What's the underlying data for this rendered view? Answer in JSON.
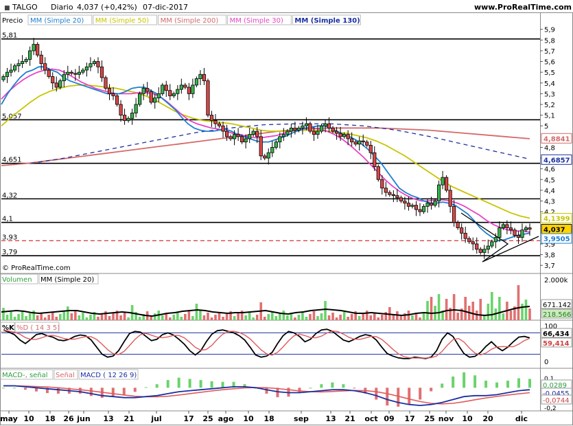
{
  "header": {
    "symbol": "TALGO",
    "period": "Diario",
    "quote": "4,037 (+0,42%)",
    "date": "07-dic-2017",
    "site": "www.ProRealTime.com"
  },
  "legend_main": {
    "price": "Precio",
    "items": [
      {
        "label": "MM (Simple 20)",
        "color": "#1e7fd0"
      },
      {
        "label": "MM (Simple 50)",
        "color": "#c8c400"
      },
      {
        "label": "MM (Simple 200)",
        "color": "#d46a6a"
      },
      {
        "label": "MM (Simple 30)",
        "color": "#e844c4"
      },
      {
        "label": "MM (Simple 130)",
        "color": "#1a2fa0"
      }
    ]
  },
  "copyright": "© ProRealTime.com",
  "level_labels": [
    "5,81",
    "5,057",
    "4,651",
    "4,32",
    "4,1",
    "3,93",
    "3,79"
  ],
  "price_axis_ticks": [
    "5,9",
    "5,8",
    "5,7",
    "5,6",
    "5,5",
    "5,4",
    "5,3",
    "5,2",
    "5,1",
    "5",
    "4,8",
    "4,7",
    "4,6",
    "4,5",
    "4,4",
    "4,3",
    "4,2",
    "3,9",
    "3,8",
    "3,7"
  ],
  "right_value_tags": [
    {
      "label": "4,8841",
      "value": 4.8841,
      "color": "#d46a6a"
    },
    {
      "label": "4,6857",
      "value": 4.6857,
      "color": "#1a2fa0"
    },
    {
      "label": "4,1399",
      "value": 4.1399,
      "color": "#c8c400"
    },
    {
      "label": "4,037",
      "value": 4.037,
      "color": "#000000"
    },
    {
      "label": "3,9505",
      "value": 3.9505,
      "color": "#1e7fd0"
    }
  ],
  "volume": {
    "legend": [
      "Volumen",
      "MM (Simple 20)"
    ],
    "axis_ticks": [
      "2.000k"
    ],
    "tags": [
      "671.142",
      "218.566"
    ]
  },
  "stochastic": {
    "legend": [
      "%K",
      "%D ( 14 3 5)"
    ],
    "axis_ticks": [
      "100",
      "50",
      "0"
    ],
    "tags": [
      "66,434",
      "59,414"
    ]
  },
  "macd": {
    "legend": [
      "MACD-, señal",
      "Señal",
      "MACD ( 12 26 9)"
    ],
    "axis_ticks": [
      "0,1",
      "-0,1",
      "-0,2"
    ],
    "tags": [
      "0,0289",
      "-0,0455",
      "-0,0744"
    ]
  },
  "x_axis_labels": [
    "may",
    "10",
    "18",
    "26",
    "jun",
    "13",
    "21",
    "jul",
    "17",
    "25",
    "ago",
    "10",
    "18",
    "sep",
    "13",
    "21",
    "oct",
    "09",
    "17",
    "25",
    "nov",
    "10",
    "20",
    "dic"
  ],
  "chart_data": {
    "type": "candlestick",
    "title": "TALGO Diario",
    "ylim": [
      3.65,
      5.93
    ],
    "horizontal_levels": [
      5.81,
      5.057,
      4.651,
      4.32,
      4.1,
      3.79
    ],
    "dashed_level": 3.93,
    "series": [
      {
        "name": "Precio",
        "values": [
          5.46,
          5.5,
          5.52,
          5.56,
          5.58,
          5.6,
          5.62,
          5.7,
          5.76,
          5.66,
          5.58,
          5.52,
          5.46,
          5.4,
          5.36,
          5.42,
          5.48,
          5.5,
          5.49,
          5.48,
          5.5,
          5.52,
          5.55,
          5.58,
          5.6,
          5.55,
          5.45,
          5.35,
          5.3,
          5.28,
          5.2,
          5.1,
          5.05,
          5.07,
          5.12,
          5.2,
          5.3,
          5.35,
          5.32,
          5.22,
          5.26,
          5.3,
          5.38,
          5.33,
          5.28,
          5.3,
          5.34,
          5.38,
          5.36,
          5.3,
          5.38,
          5.44,
          5.48,
          5.42,
          5.1,
          5.05,
          5.02,
          5.0,
          4.95,
          4.9,
          4.88,
          4.92,
          4.9,
          4.85,
          4.88,
          4.92,
          4.95,
          4.9,
          4.72,
          4.7,
          4.75,
          4.8,
          4.85,
          4.9,
          4.92,
          4.95,
          4.98,
          4.96,
          4.98,
          5.0,
          5.02,
          4.95,
          4.92,
          4.95,
          5.0,
          5.02,
          4.98,
          4.95,
          4.93,
          4.9,
          4.92,
          4.88,
          4.85,
          4.83,
          4.86,
          4.85,
          4.82,
          4.75,
          4.62,
          4.5,
          4.42,
          4.38,
          4.36,
          4.35,
          4.33,
          4.3,
          4.28,
          4.25,
          4.26,
          4.22,
          4.2,
          4.25,
          4.28,
          4.26,
          4.3,
          4.45,
          4.52,
          4.4,
          4.25,
          4.1,
          4.05,
          4.0,
          3.95,
          3.92,
          3.9,
          3.85,
          3.82,
          3.85,
          3.88,
          3.92,
          3.96,
          4.05,
          4.08,
          4.05,
          4.03,
          3.98,
          3.96,
          4.03,
          4.05,
          4.037
        ]
      },
      {
        "name": "MM (Simple 20)",
        "values": [
          5.2,
          5.3,
          5.38,
          5.45,
          5.5,
          5.52,
          5.55,
          5.55,
          5.52,
          5.5,
          5.45,
          5.42,
          5.4,
          5.38,
          5.36,
          5.34,
          5.32,
          5.3,
          5.3,
          5.3,
          5.32,
          5.35,
          5.36,
          5.36,
          5.33,
          5.3,
          5.25,
          5.2,
          5.15,
          5.08,
          5.02,
          4.98,
          4.96,
          4.95,
          4.95,
          4.96,
          4.97,
          4.95,
          4.92,
          4.9,
          4.88,
          4.86,
          4.85,
          4.85,
          4.87,
          4.89,
          4.91,
          4.94,
          4.96,
          4.98,
          4.99,
          5.0,
          5.0,
          4.98,
          4.95,
          4.92,
          4.9,
          4.87,
          4.83,
          4.78,
          4.72,
          4.66,
          4.58,
          4.5,
          4.42,
          4.38,
          4.35,
          4.33,
          4.3,
          4.28,
          4.28,
          4.29,
          4.28,
          4.26,
          4.22,
          4.18,
          4.12,
          4.05,
          4.0,
          3.96,
          3.93,
          3.94,
          3.96,
          3.98,
          3.99,
          4.0
        ]
      },
      {
        "name": "MM (Simple 30)",
        "values": [
          5.25,
          5.32,
          5.38,
          5.43,
          5.47,
          5.5,
          5.52,
          5.53,
          5.52,
          5.49,
          5.45,
          5.41,
          5.38,
          5.35,
          5.33,
          5.31,
          5.3,
          5.3,
          5.3,
          5.31,
          5.31,
          5.3,
          5.27,
          5.22,
          5.16,
          5.1,
          5.05,
          5.02,
          5.0,
          4.98,
          4.97,
          4.95,
          4.93,
          4.92,
          4.9,
          4.89,
          4.89,
          4.9,
          4.91,
          4.93,
          4.95,
          4.97,
          4.98,
          4.98,
          4.97,
          4.95,
          4.92,
          4.88,
          4.83,
          4.77,
          4.71,
          4.64,
          4.57,
          4.5,
          4.44,
          4.39,
          4.35,
          4.32,
          4.3,
          4.3,
          4.31,
          4.31,
          4.3,
          4.28,
          4.25,
          4.21,
          4.17,
          4.12,
          4.08,
          4.05,
          4.03,
          4.02,
          4.02,
          4.01
        ]
      },
      {
        "name": "MM (Simple 50)",
        "values": [
          5.0,
          5.08,
          5.15,
          5.22,
          5.28,
          5.32,
          5.35,
          5.37,
          5.38,
          5.38,
          5.37,
          5.36,
          5.35,
          5.33,
          5.31,
          5.28,
          5.24,
          5.19,
          5.14,
          5.1,
          5.07,
          5.05,
          5.04,
          5.03,
          5.02,
          5.0,
          4.98,
          4.96,
          4.95,
          4.95,
          4.95,
          4.96,
          4.96,
          4.96,
          4.95,
          4.94,
          4.93,
          4.91,
          4.89,
          4.86,
          4.82,
          4.77,
          4.72,
          4.66,
          4.6,
          4.54,
          4.48,
          4.43,
          4.39,
          4.35,
          4.31,
          4.27,
          4.23,
          4.19,
          4.16,
          4.14
        ]
      },
      {
        "name": "MM (Simple 200)",
        "values": [
          4.63,
          4.65,
          4.68,
          4.71,
          4.74,
          4.77,
          4.8,
          4.83,
          4.86,
          4.89,
          4.92,
          4.95,
          4.97,
          4.98,
          4.98,
          4.98,
          4.97,
          4.96,
          4.94,
          4.92,
          4.9,
          4.88
        ]
      },
      {
        "name": "MM (Simple 130)",
        "values": [
          4.65,
          4.7,
          4.76,
          4.82,
          4.88,
          4.94,
          4.98,
          5.01,
          5.02,
          5.02,
          5.0,
          4.96,
          4.9,
          4.83,
          4.76,
          4.69
        ]
      }
    ]
  }
}
